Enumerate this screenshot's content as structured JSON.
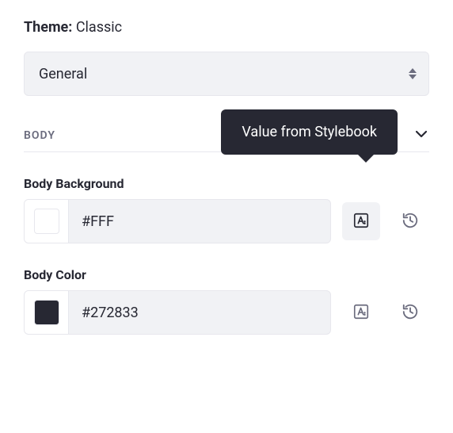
{
  "theme": {
    "label": "Theme:",
    "value": "Classic"
  },
  "category_select": {
    "selected": "General"
  },
  "section": {
    "title": "BODY"
  },
  "tooltip": {
    "text": "Value from Stylebook"
  },
  "fields": {
    "body_background": {
      "label": "Body Background",
      "value": "#FFF",
      "swatch": "#FFFFFF"
    },
    "body_color": {
      "label": "Body Color",
      "value": "#272833",
      "swatch": "#272833"
    }
  }
}
